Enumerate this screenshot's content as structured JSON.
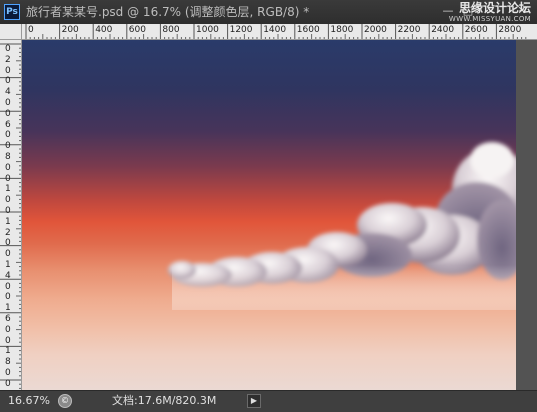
{
  "app": {
    "icon_label": "Ps"
  },
  "document": {
    "title": "旅行者某某号.psd @ 16.7% (调整颜色层, RGB/8) *"
  },
  "window_controls": {
    "minimize": "—",
    "maximize": "□",
    "close": "✕"
  },
  "watermark": {
    "main": "思缘设计论坛",
    "sub": "WWW.MISSYUAN.COM"
  },
  "rulers": {
    "horizontal": [
      "0",
      "200",
      "400",
      "600",
      "800",
      "1000",
      "1200",
      "1400",
      "1600",
      "1800",
      "2000",
      "2200",
      "2400",
      "2600",
      "2800"
    ],
    "vertical": [
      "0",
      "2",
      "0",
      "0",
      "4",
      "0",
      "0",
      "6",
      "0",
      "0",
      "8",
      "0",
      "0",
      "1",
      "0",
      "0",
      "1",
      "2",
      "0",
      "0",
      "1",
      "4",
      "0",
      "0",
      "1",
      "6",
      "0",
      "0",
      "1",
      "8",
      "0",
      "0"
    ]
  },
  "status": {
    "zoom": "16.67%",
    "doc_size": "文档:17.6M/820.3M",
    "arrow": "▶"
  },
  "colors": {
    "sky_top": "#2a3b6a",
    "horizon": "#e1553a",
    "bottom": "#ebd9d3",
    "ps_accent": "#4fa3ff"
  }
}
